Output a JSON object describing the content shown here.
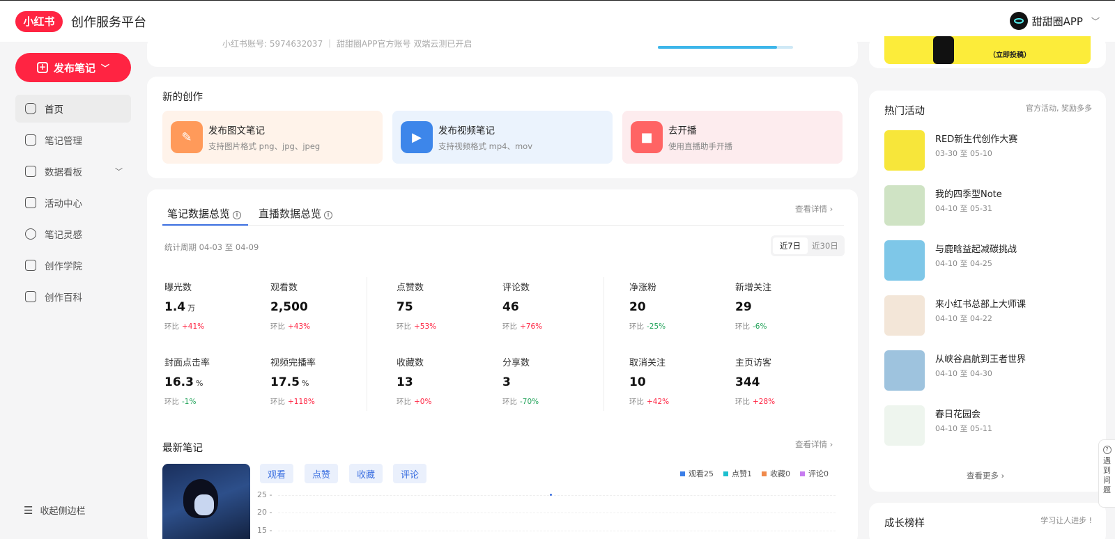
{
  "header": {
    "logo_text": "小红书",
    "platform_title": "创作服务平台",
    "user_name": "甜甜圈APP"
  },
  "sidebar": {
    "publish_label": "发布笔记",
    "items": [
      {
        "label": "首页",
        "icon": "home-icon",
        "active": true
      },
      {
        "label": "笔记管理",
        "icon": "notes-icon"
      },
      {
        "label": "数据看板",
        "icon": "chart-icon",
        "expandable": true
      },
      {
        "label": "活动中心",
        "icon": "flag-icon"
      },
      {
        "label": "笔记灵感",
        "icon": "bulb-icon"
      },
      {
        "label": "创作学院",
        "icon": "graduation-icon"
      },
      {
        "label": "创作百科",
        "icon": "book-icon"
      }
    ],
    "collapse_label": "收起侧边栏"
  },
  "profile": {
    "account_text": "小红书账号: 5974632037 ｜ 甜甜圈APP官方账号 双端云测已开启"
  },
  "creation": {
    "title": "新的创作",
    "tiles": [
      {
        "title": "发布图文笔记",
        "subtitle": "支持图片格式 png、jpg、jpeg",
        "bg": "#fff3ea",
        "icon_bg": "#ff9a5a"
      },
      {
        "title": "发布视频笔记",
        "subtitle": "支持视频格式 mp4、mov",
        "bg": "#ebf3fd",
        "icon_bg": "#3d86ea"
      },
      {
        "title": "去开播",
        "subtitle": "使用直播助手开播",
        "bg": "#fdecee",
        "icon_bg": "#ff6464"
      }
    ]
  },
  "stats": {
    "tab_notes": "笔记数据总览",
    "tab_live": "直播数据总览",
    "view_details": "查看详情",
    "period": "统计周期 04-03 至 04-09",
    "range_7": "近7日",
    "range_30": "近30日",
    "compare_label": "环比",
    "metrics": [
      {
        "label": "曝光数",
        "value": "1.4",
        "unit": "万",
        "change": "+41%",
        "dir": "up"
      },
      {
        "label": "观看数",
        "value": "2,500",
        "unit": "",
        "change": "+43%",
        "dir": "up"
      },
      {
        "label": "点赞数",
        "value": "75",
        "unit": "",
        "change": "+53%",
        "dir": "up"
      },
      {
        "label": "评论数",
        "value": "46",
        "unit": "",
        "change": "+76%",
        "dir": "up"
      },
      {
        "label": "净涨粉",
        "value": "20",
        "unit": "",
        "change": "-25%",
        "dir": "down"
      },
      {
        "label": "新增关注",
        "value": "29",
        "unit": "",
        "change": "-6%",
        "dir": "down"
      },
      {
        "label": "封面点击率",
        "value": "16.3",
        "unit": "%",
        "change": "-1%",
        "dir": "down"
      },
      {
        "label": "视频完播率",
        "value": "17.5",
        "unit": "%",
        "change": "+118%",
        "dir": "up"
      },
      {
        "label": "收藏数",
        "value": "13",
        "unit": "",
        "change": "+0%",
        "dir": "up"
      },
      {
        "label": "分享数",
        "value": "3",
        "unit": "",
        "change": "-70%",
        "dir": "down"
      },
      {
        "label": "取消关注",
        "value": "10",
        "unit": "",
        "change": "+42%",
        "dir": "up"
      },
      {
        "label": "主页访客",
        "value": "344",
        "unit": "",
        "change": "+28%",
        "dir": "up"
      }
    ]
  },
  "latest": {
    "title": "最新笔记",
    "view_details": "查看详情",
    "chips": [
      "观看",
      "点赞",
      "收藏",
      "评论"
    ],
    "legend": [
      {
        "label": "观看25",
        "color": "#3b7ee8"
      },
      {
        "label": "点赞1",
        "color": "#1dbfcf"
      },
      {
        "label": "收藏0",
        "color": "#f08a4b"
      },
      {
        "label": "评论0",
        "color": "#c77cf0"
      }
    ],
    "y_ticks": [
      "25 -",
      "20 -",
      "15 -"
    ]
  },
  "banner": {
    "cta": "（立即投稿）"
  },
  "activities": {
    "title": "热门活动",
    "subtitle": "官方活动, 奖励多多",
    "items": [
      {
        "title": "RED新生代创作大赛",
        "date": "03-30 至 05-10",
        "color": "#f7e63a"
      },
      {
        "title": "我的四季型Note",
        "date": "04-10 至 05-31",
        "color": "#cfe3c4"
      },
      {
        "title": "与鹿晗益起减碳挑战",
        "date": "04-10 至 04-25",
        "color": "#7ec7e8"
      },
      {
        "title": "来小红书总部上大师课",
        "date": "04-10 至 04-22",
        "color": "#f3e6d8"
      },
      {
        "title": "从峡谷启航到王者世界",
        "date": "04-10 至 04-30",
        "color": "#9ec3de"
      },
      {
        "title": "春日花园会",
        "date": "04-10 至 05-11",
        "color": "#eef5ee"
      }
    ],
    "more_label": "查看更多"
  },
  "growth": {
    "title": "成长榜样",
    "subtitle": "学习让人进步 !"
  },
  "help": {
    "label": "遇到问题"
  }
}
